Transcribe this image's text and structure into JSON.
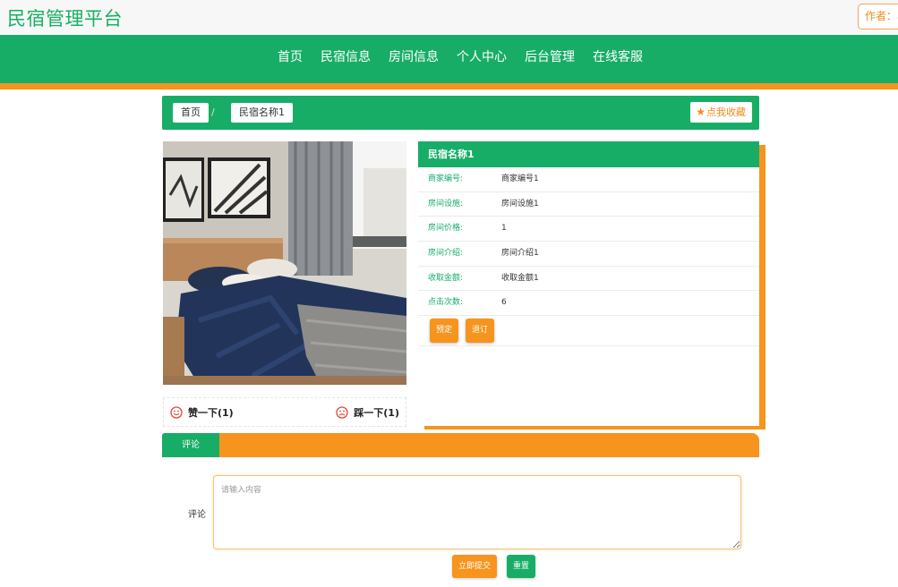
{
  "header": {
    "site_title": "民宿管理平台",
    "author_label": "作者：a"
  },
  "nav": {
    "items": [
      "首页",
      "民宿信息",
      "房间信息",
      "个人中心",
      "后台管理",
      "在线客服"
    ]
  },
  "breadcrumb": {
    "home": "首页",
    "separator": "/",
    "current": "民宿名称1",
    "favorite": "点我收藏"
  },
  "detail": {
    "title": "民宿名称1",
    "fields": [
      {
        "label": "商家编号:",
        "value": "商家编号1"
      },
      {
        "label": "房间设施:",
        "value": "房间设施1"
      },
      {
        "label": "房间价格:",
        "value": "1"
      },
      {
        "label": "房间介绍:",
        "value": "房间介绍1"
      },
      {
        "label": "收取金额:",
        "value": "收取金额1"
      },
      {
        "label": "点击次数:",
        "value": "6"
      }
    ],
    "book_button": "预定",
    "cancel_button": "退订"
  },
  "votes": {
    "like": "赞一下(1)",
    "dislike": "踩一下(1)"
  },
  "comments": {
    "tab": "评论",
    "label": "评论",
    "placeholder": "请输入内容",
    "submit": "立即提交",
    "reset": "重置"
  },
  "colors": {
    "primary_green": "#17ad66",
    "accent_orange": "#f7941d"
  }
}
